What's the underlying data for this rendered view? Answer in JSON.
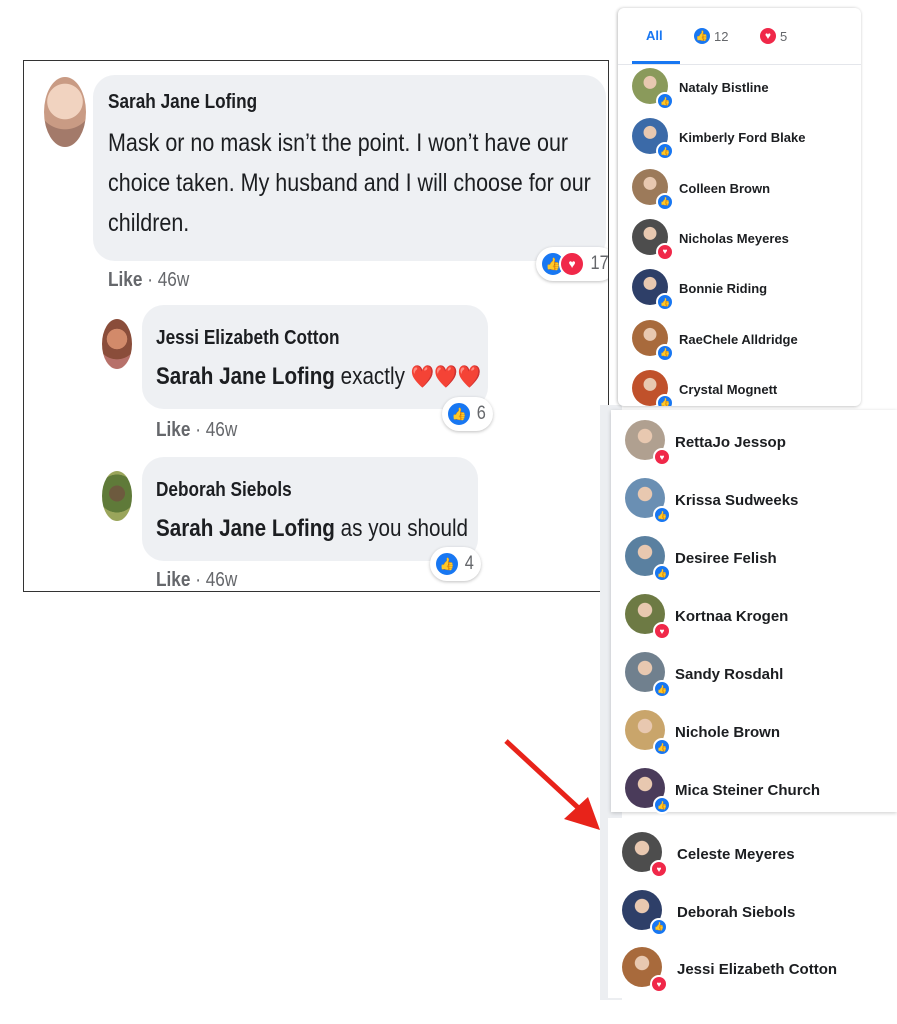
{
  "thread": {
    "main_comment": {
      "author": "Sarah Jane Lofing",
      "text_lines": [
        "Mask or no mask isn’t the point. I won’t have our",
        "choice taken. My husband and I will choose for our",
        "children."
      ],
      "like": "Like",
      "time": "· 46w",
      "reaction_count": "17"
    },
    "reply1": {
      "author": "Jessi Elizabeth Cotton",
      "mention": "Sarah Jane Lofing",
      "text": " exactly ",
      "hearts": "❤️❤️❤️",
      "like": "Like",
      "time": "· 46w",
      "reaction_count": "6"
    },
    "reply2": {
      "author": "Deborah Siebols",
      "mention": "Sarah Jane Lofing",
      "text": " as you should",
      "like": "Like",
      "time": "· 46w",
      "reaction_count": "4"
    }
  },
  "reactions_panel": {
    "tabs": [
      {
        "label": "All"
      },
      {
        "label": "12",
        "icon": "like-icon"
      },
      {
        "label": "5",
        "icon": "love-icon"
      }
    ],
    "people": [
      {
        "name": "Nataly Bistline",
        "reaction": "like"
      },
      {
        "name": "Kimberly Ford Blake",
        "reaction": "like"
      },
      {
        "name": "Colleen Brown",
        "reaction": "like"
      },
      {
        "name": "Nicholas Meyeres",
        "reaction": "love"
      },
      {
        "name": "Bonnie Riding",
        "reaction": "like"
      },
      {
        "name": "RaeChele Alldridge",
        "reaction": "like"
      },
      {
        "name": "Crystal Mognett",
        "reaction": "like"
      }
    ]
  },
  "panel2": {
    "people": [
      {
        "name": "RettaJo Jessop",
        "reaction": "love"
      },
      {
        "name": "Krissa Sudweeks",
        "reaction": "like"
      },
      {
        "name": "Desiree Felish",
        "reaction": "like"
      },
      {
        "name": "Kortnaa Krogen",
        "reaction": "love"
      },
      {
        "name": "Sandy Rosdahl",
        "reaction": "like"
      },
      {
        "name": "Nichole Brown",
        "reaction": "like"
      },
      {
        "name": "Mica Steiner Church",
        "reaction": "like"
      }
    ]
  },
  "panel3": {
    "people": [
      {
        "name": "Celeste Meyeres",
        "reaction": "love"
      },
      {
        "name": "Deborah Siebols",
        "reaction": "like"
      },
      {
        "name": "Jessi Elizabeth Cotton",
        "reaction": "love"
      }
    ]
  },
  "colors": {
    "like": "#1877f2",
    "love": "#f02849",
    "arrow": "#e8231a",
    "bubble": "#eef0f3"
  }
}
